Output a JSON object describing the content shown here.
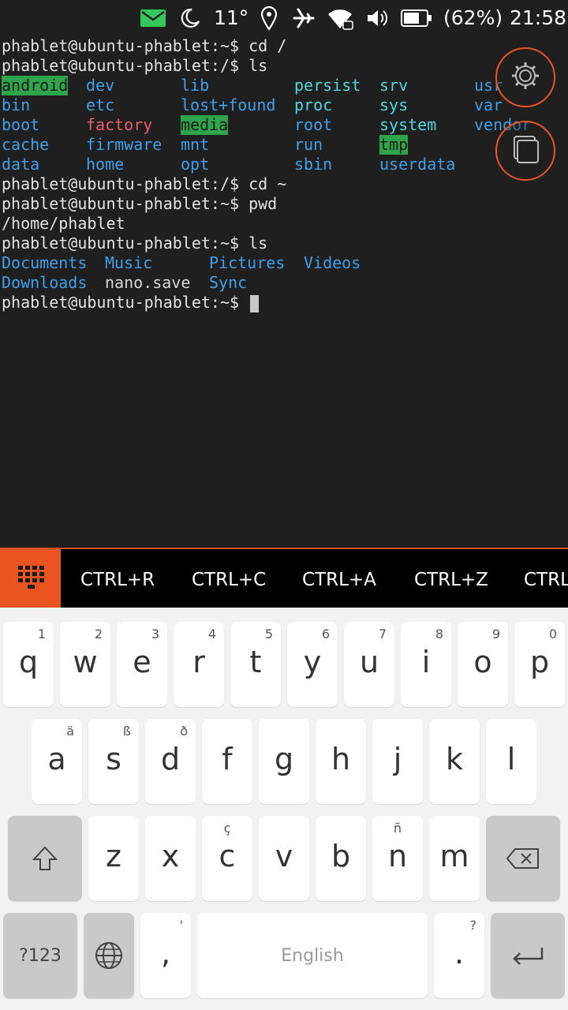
{
  "status_bar": {
    "temperature": "11°",
    "battery_percent": "(62%)",
    "time": "21:58",
    "icons": [
      "message-icon",
      "night-mode-icon",
      "location-icon",
      "airplane-icon",
      "wifi-icon",
      "volume-icon",
      "battery-icon"
    ],
    "colors": {
      "message": "#34c759"
    }
  },
  "terminal": {
    "prompt_lines": [
      "phablet@ubuntu-phablet:~$ cd /",
      "phablet@ubuntu-phablet:/$ ls"
    ],
    "root_listing": [
      [
        "android",
        "dev",
        "lib",
        "persist",
        "srv",
        "usr"
      ],
      [
        "bin",
        "etc",
        "lost+found",
        "proc",
        "sys",
        "var"
      ],
      [
        "boot",
        "factory",
        "media",
        "root",
        "system",
        "vendor"
      ],
      [
        "cache",
        "firmware",
        "mnt",
        "run",
        "tmp",
        ""
      ],
      [
        "data",
        "home",
        "opt",
        "sbin",
        "userdata",
        ""
      ]
    ],
    "after_lines": [
      "phablet@ubuntu-phablet:/$ cd ~",
      "phablet@ubuntu-phablet:~$ pwd",
      "/home/phablet",
      "phablet@ubuntu-phablet:~$ ls"
    ],
    "home_listing": [
      [
        "Documents",
        "Music",
        "Pictures",
        "Videos"
      ],
      [
        "Downloads",
        "nano.save",
        "Sync",
        ""
      ]
    ],
    "current_prompt": "phablet@ubuntu-phablet:~$ ",
    "colors": {
      "dir": "#3ea0ea",
      "highlight_bg": "#2fa54b",
      "factory": "#e85d6a",
      "persist_group": "#4dd7e0"
    }
  },
  "fab": {
    "settings_icon": "gear-icon",
    "tabs_icon": "tabs-icon"
  },
  "shortcuts": [
    "CTRL+R",
    "CTRL+C",
    "CTRL+A",
    "CTRL+Z",
    "CTRL"
  ],
  "keyboard": {
    "row1": [
      {
        "key": "q",
        "sub": "1"
      },
      {
        "key": "w",
        "sub": "2"
      },
      {
        "key": "e",
        "sub": "3"
      },
      {
        "key": "r",
        "sub": "4"
      },
      {
        "key": "t",
        "sub": "5"
      },
      {
        "key": "y",
        "sub": "6"
      },
      {
        "key": "u",
        "sub": "7"
      },
      {
        "key": "i",
        "sub": "8"
      },
      {
        "key": "o",
        "sub": "9"
      },
      {
        "key": "p",
        "sub": "0"
      }
    ],
    "row2": [
      {
        "key": "a",
        "sub": "ä"
      },
      {
        "key": "s",
        "sub": "ß"
      },
      {
        "key": "d",
        "sub": "ð"
      },
      {
        "key": "f",
        "sub": ""
      },
      {
        "key": "g",
        "sub": ""
      },
      {
        "key": "h",
        "sub": ""
      },
      {
        "key": "j",
        "sub": ""
      },
      {
        "key": "k",
        "sub": ""
      },
      {
        "key": "l",
        "sub": ""
      }
    ],
    "row3": [
      {
        "key": "z",
        "sub": ""
      },
      {
        "key": "x",
        "sub": ""
      },
      {
        "key": "c",
        "sub": "ç"
      },
      {
        "key": "v",
        "sub": ""
      },
      {
        "key": "b",
        "sub": ""
      },
      {
        "key": "n",
        "sub": "ñ"
      },
      {
        "key": "m",
        "sub": ""
      }
    ],
    "symbols_label": "?123",
    "comma": ",",
    "comma_sub": "'",
    "space_label": "English",
    "period": ".",
    "period_sub": "?",
    "icons": {
      "shift": "shift-icon",
      "backspace": "backspace-icon",
      "language": "globe-icon",
      "enter": "enter-icon"
    }
  }
}
